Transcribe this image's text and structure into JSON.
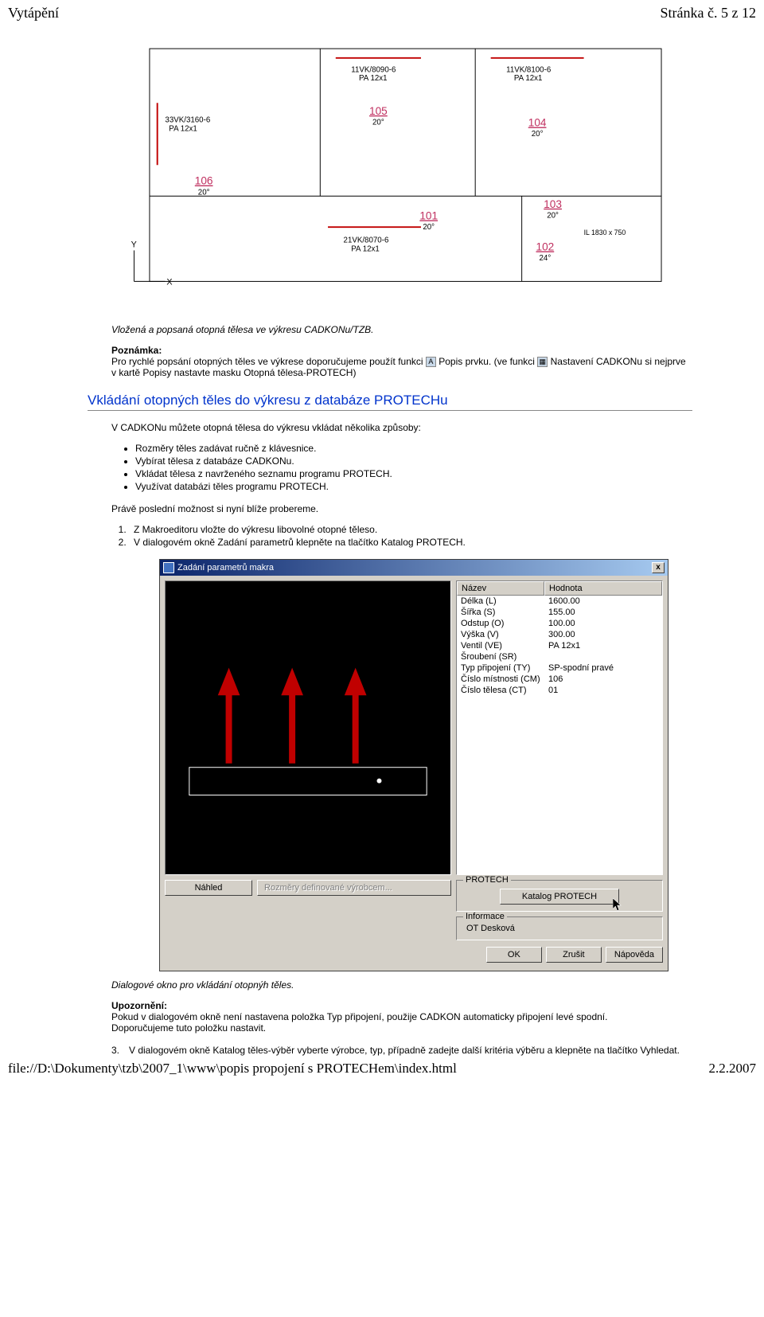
{
  "header": {
    "left": "Vytápění",
    "right": "Stránka č. 5 z 12"
  },
  "drawing": {
    "labels": [
      {
        "t": "11VK/8090-6",
        "s": "PA 12x1"
      },
      {
        "t": "11VK/8100-6",
        "s": "PA 12x1"
      },
      {
        "t": "33VK/3160-6",
        "s": "PA 12x1"
      },
      {
        "t": "21VK/8070-6",
        "s": "PA 12x1"
      }
    ],
    "rooms": [
      {
        "num": "105",
        "temp": "20°"
      },
      {
        "num": "104",
        "temp": "20°"
      },
      {
        "num": "106",
        "temp": "20°"
      },
      {
        "num": "101",
        "temp": "20°"
      },
      {
        "num": "103",
        "temp": "20°"
      },
      {
        "num": "102",
        "temp": "24°"
      }
    ],
    "bath_label": "IL 1830 x 750",
    "axis_x": "X",
    "axis_y": "Y"
  },
  "caption1": "Vložená a popsaná otopná tělesa ve výkresu CADKONu/TZB.",
  "note1": {
    "title": "Poznámka:",
    "before_icon1": "Pro rychlé popsání otopných těles ve výkrese doporučujeme použít funkci ",
    "after_icon1": " Popis prvku. (ve funkci ",
    "after_icon2": " Nastavení CADKONu si nejprve v kartě Popisy nastavte masku Otopná tělesa-PROTECH)"
  },
  "heading1": "Vkládání otopných těles do výkresu z databáze PROTECHu",
  "p1": "V CADKONu můžete otopná tělesa do výkresu vkládat několika způsoby:",
  "bullets": [
    "Rozměry těles zadávat ručně z klávesnice.",
    "Vybírat tělesa z databáze CADKONu.",
    "Vkládat tělesa z navrženého seznamu programu PROTECH.",
    "Využívat databázi těles programu PROTECH."
  ],
  "p2": "Právě poslední možnost si nyní blíže probereme.",
  "steps": [
    "Z Makroeditoru vložte do výkresu libovolné otopné těleso.",
    "V dialogovém okně Zadání parametrů klepněte na tlačítko Katalog PROTECH."
  ],
  "dialog": {
    "title": "Zadání parametrů makra",
    "close": "x",
    "headers": {
      "name": "Název",
      "value": "Hodnota"
    },
    "params": [
      {
        "n": "Délka (L)",
        "v": "1600.00"
      },
      {
        "n": "Šířka (S)",
        "v": "155.00"
      },
      {
        "n": "Odstup (O)",
        "v": "100.00"
      },
      {
        "n": "Výška (V)",
        "v": "300.00"
      },
      {
        "n": "Ventil (VE)",
        "v": "PA 12x1"
      },
      {
        "n": "Šroubení (SR)",
        "v": ""
      },
      {
        "n": "Typ připojení (TY)",
        "v": "SP-spodní pravé"
      },
      {
        "n": "Číslo místnosti (CM)",
        "v": "106"
      },
      {
        "n": "Číslo tělesa (CT)",
        "v": "01"
      }
    ],
    "btn_nahled": "Náhled",
    "btn_rozmery": "Rozměry definované výrobcem...",
    "group_protech": "PROTECH",
    "btn_katalog": "Katalog PROTECH",
    "group_info": "Informace",
    "info_text": "OT Desková",
    "btn_ok": "OK",
    "btn_cancel": "Zrušit",
    "btn_help": "Nápověda"
  },
  "caption2": "Dialogové okno pro vkládání otopnýh těles.",
  "warn": {
    "title": "Upozornění:",
    "l1": "Pokud v dialogovém okně není nastavena položka Typ připojení, použije CADKON automaticky připojení levé spodní.",
    "l2": "Doporučujeme tuto položku nastavit."
  },
  "step3": {
    "num": "3.",
    "text": "V dialogovém okně Katalog těles-výběr vyberte výrobce, typ, případně zadejte další kritéria výběru a klepněte na tlačítko Vyhledat."
  },
  "footer": {
    "path": "file://D:\\Dokumenty\\tzb\\2007_1\\www\\popis propojení s PROTECHem\\index.html",
    "date": "2.2.2007"
  }
}
